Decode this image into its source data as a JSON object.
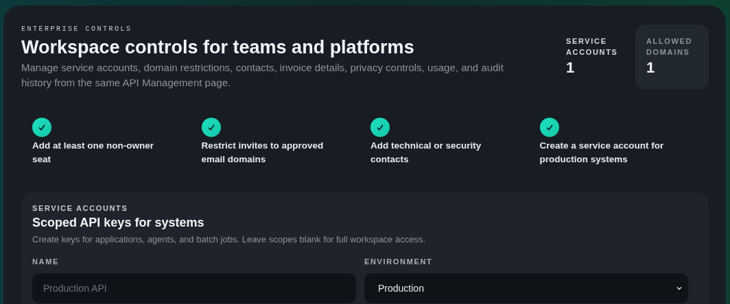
{
  "header": {
    "eyebrow": "ENTERPRISE CONTROLS",
    "title": "Workspace controls for teams and platforms",
    "description": "Manage service accounts, domain restrictions, contacts, invoice details, privacy controls, usage, and audit history from the same API Management page."
  },
  "stats": [
    {
      "label": "SERVICE ACCOUNTS",
      "value": "1",
      "selected": false
    },
    {
      "label": "ALLOWED DOMAINS",
      "value": "1",
      "selected": true
    }
  ],
  "checklist": [
    {
      "label": "Add at least one non-owner seat",
      "checked": true
    },
    {
      "label": "Restrict invites to approved email domains",
      "checked": true
    },
    {
      "label": "Add technical or security contacts",
      "checked": true
    },
    {
      "label": "Create a service account for production systems",
      "checked": true
    }
  ],
  "service_accounts": {
    "eyebrow": "SERVICE ACCOUNTS",
    "title": "Scoped API keys for systems",
    "description": "Create keys for applications, agents, and batch jobs. Leave scopes blank for full workspace access.",
    "fields": [
      {
        "kind": "text",
        "label": "NAME",
        "placeholder": "Production API"
      },
      {
        "kind": "select",
        "label": "ENVIRONMENT",
        "value": "Production"
      }
    ]
  }
}
